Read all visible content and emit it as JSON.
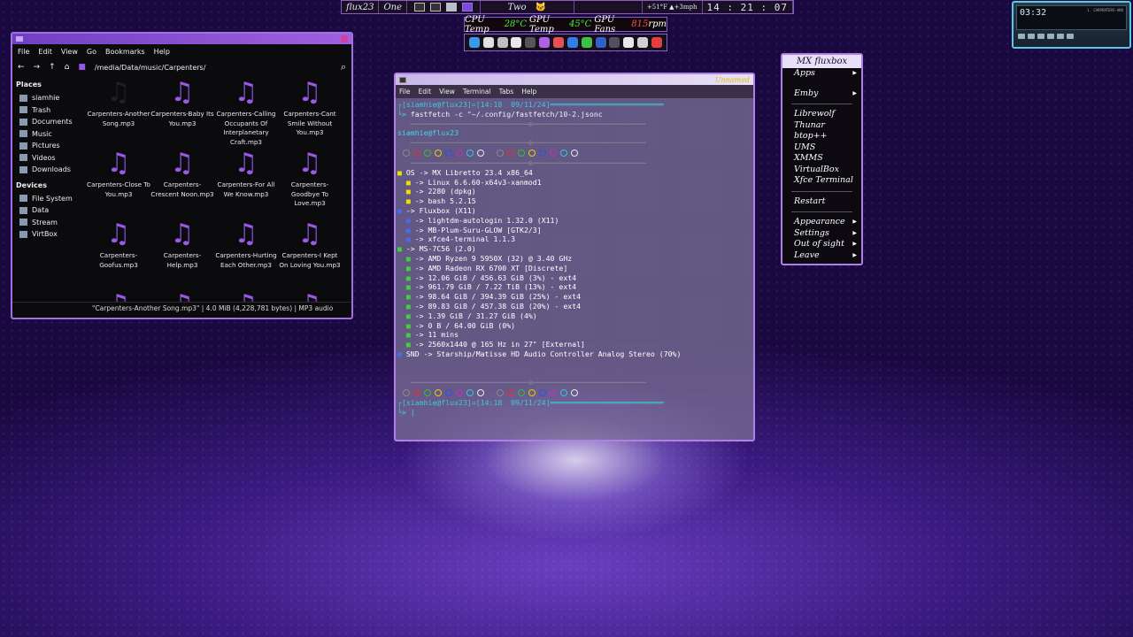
{
  "toolbar": {
    "host": "flux23",
    "workspace1": "One",
    "workspace2": "Two",
    "weather": "+51°F  ▲+3mph",
    "clock": "14 : 21 : 07"
  },
  "sensors": {
    "cpu_label": "CPU Temp",
    "cpu_val": "28°C",
    "gpu_label": "GPU Temp",
    "gpu_val": "45°C",
    "fan_label": "GPU Fans",
    "fan_val": "815",
    "fan_unit": "rpm"
  },
  "launcher_colors": [
    "#3a9ae8",
    "#e0e0e0",
    "#c0c0c0",
    "#e8e8e8",
    "#555555",
    "#b060e8",
    "#e85050",
    "#3080e8",
    "#40c040",
    "#3060c8",
    "#505060",
    "#e8e8e8",
    "#d0d0d0",
    "#e04040"
  ],
  "player": {
    "time": "03:32",
    "track": "1. CARPENTERS-ANO"
  },
  "file_manager": {
    "menu": [
      "File",
      "Edit",
      "View",
      "Go",
      "Bookmarks",
      "Help"
    ],
    "path": "/media/Data/music/Carpenters/",
    "places_header": "Places",
    "places": [
      "siamhie",
      "Trash",
      "Documents",
      "Music",
      "Pictures",
      "Videos",
      "Downloads"
    ],
    "devices_header": "Devices",
    "devices": [
      "File System",
      "Data",
      "Stream",
      "VirtBox"
    ],
    "files": [
      "Carpenters-Another Song.mp3",
      "Carpenters-Baby Its You.mp3",
      "Carpenters-Calling Occupants Of Interplanetary Craft.mp3",
      "Carpenters-Cant Smile Without You.mp3",
      "Carpenters-Close To You.mp3",
      "Carpenters-Crescent Noon.mp3",
      "Carpenters-For All We Know.mp3",
      "Carpenters-Goodbye To Love.mp3",
      "Carpenters-Goofus.mp3",
      "Carpenters-Help.mp3",
      "Carpenters-Hurting Each Other.mp3",
      "Carpenters-I Kept On Loving You.mp3",
      "",
      "",
      "",
      ""
    ],
    "status": "\"Carpenters-Another Song.mp3\"  |  4.0 MiB (4,228,781 bytes)  |  MP3 audio"
  },
  "terminal": {
    "title": "Unnamed",
    "menu": [
      "File",
      "Edit",
      "View",
      "Terminal",
      "Tabs",
      "Help"
    ],
    "prompt1": "[siamhie@flux23]=[14:18  09/11/24]",
    "command": "fastfetch -c \"~/.config/fastfetch/10-2.jsonc",
    "userhost": "siamhie@flux23",
    "lines": [
      "OS -> MX Libretto 23.4 x86_64",
      "-> Linux 6.6.60-x64v3-xanmod1",
      "-> 2280 (dpkg)",
      "-> bash 5.2.15",
      "-> Fluxbox (X11)",
      "-> lightdm-autologin 1.32.0 (X11)",
      "-> MB-Plum-Suru-GLOW [GTK2/3]",
      "-> xfce4-terminal 1.1.3",
      "-> MS-7C56 (2.0)",
      "-> AMD Ryzen 9 5950X (32) @ 3.40 GHz",
      "-> AMD Radeon RX 6700 XT [Discrete]",
      "-> 12.06 GiB / 456.63 GiB (3%) - ext4",
      "-> 961.79 GiB / 7.22 TiB (13%) - ext4",
      "-> 98.64 GiB / 394.39 GiB (25%) - ext4",
      "-> 89.83 GiB / 457.38 GiB (20%) - ext4",
      "-> 1.39 GiB / 31.27 GiB (4%)",
      "-> 0 B / 64.00 GiB (0%)",
      "-> 11 mins",
      "-> 2560x1440 @ 165 Hz in 27\" [External]",
      "SND -> Starship/Matisse HD Audio Controller Analog Stereo (70%)"
    ],
    "prompt2": "[siamhie@flux23]=[14:18  09/11/24]"
  },
  "fluxbox_menu": {
    "title": "MX fluxbox",
    "group1": [
      "Apps",
      "Emby"
    ],
    "group2": [
      "Librewolf",
      "Thunar",
      "btop++",
      "UMS",
      "XMMS",
      "VirtualBox",
      "Xfce Terminal"
    ],
    "group3": [
      "Restart"
    ],
    "group4": [
      "Appearance",
      "Settings",
      "Out of sight",
      "Leave"
    ]
  },
  "swatch_colors": [
    "#888888",
    "#e83030",
    "#30c030",
    "#e0d000",
    "#3050e8",
    "#c030c0",
    "#30c8d8",
    "#e8e8e8"
  ]
}
